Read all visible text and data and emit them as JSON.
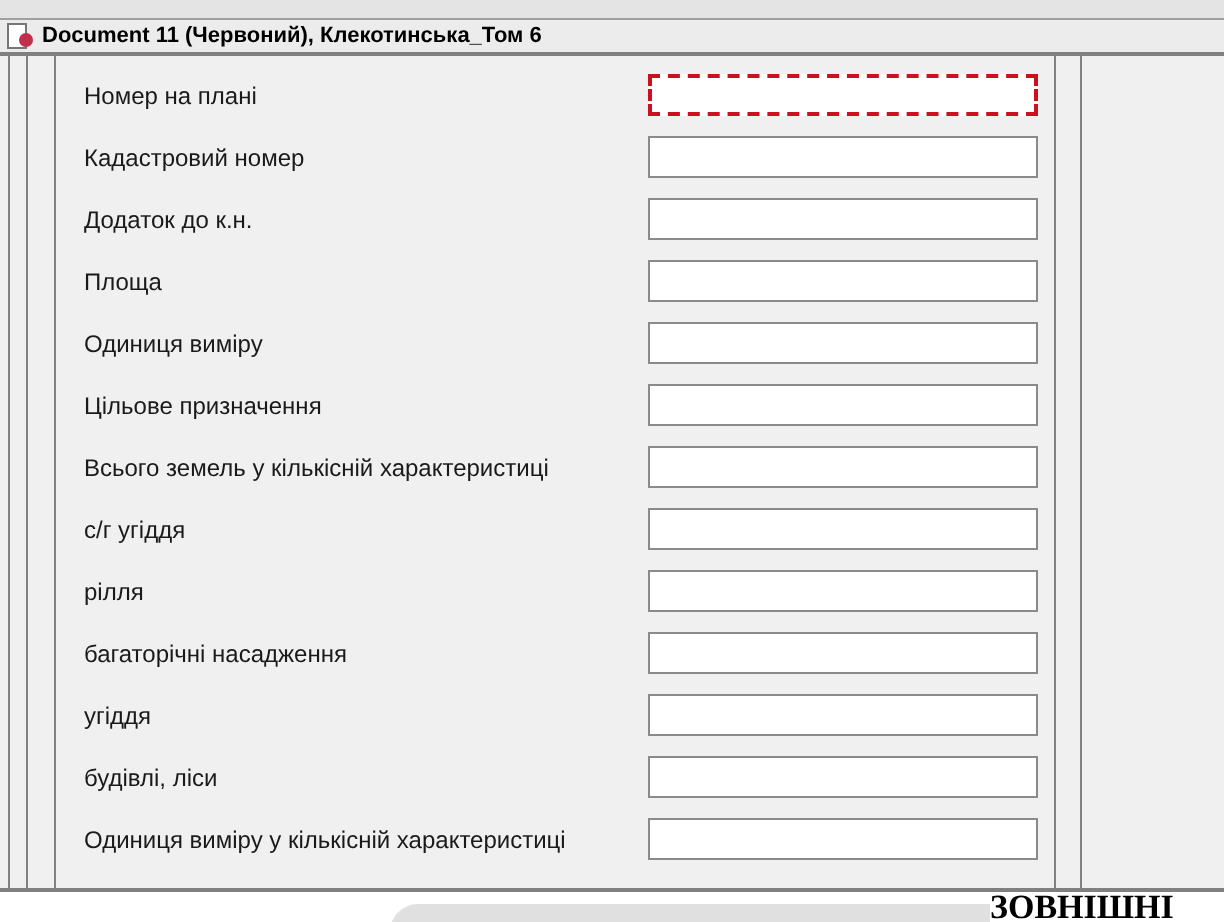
{
  "window": {
    "title": "Document 11 (Червоний), Клекотинська_Том 6"
  },
  "fields": [
    {
      "label": "Номер на плані",
      "focused": true
    },
    {
      "label": "Кадастровий номер",
      "focused": false
    },
    {
      "label": "Додаток до к.н.",
      "focused": false
    },
    {
      "label": "Площа",
      "focused": false
    },
    {
      "label": "Одиниця виміру",
      "focused": false
    },
    {
      "label": "Цільове призначення",
      "focused": false
    },
    {
      "label": "Всього земель у кількісній характеристиці",
      "focused": false
    },
    {
      "label": "с/г угіддя",
      "focused": false
    },
    {
      "label": "рілля",
      "focused": false
    },
    {
      "label": "багаторічні насадження",
      "focused": false
    },
    {
      "label": "угіддя",
      "focused": false
    },
    {
      "label": "будівлі, ліси",
      "focused": false
    },
    {
      "label": "Одиниця виміру у кількісній характеристиці",
      "focused": false
    }
  ],
  "footer": {
    "heading": "ЗОВНІШНІ"
  }
}
